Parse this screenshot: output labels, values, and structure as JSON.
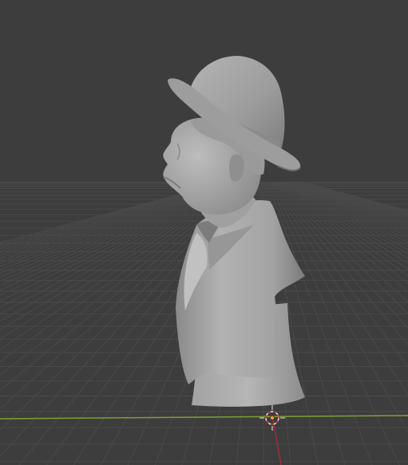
{
  "viewport": {
    "mode": "3d-viewport",
    "view": "perspective-side",
    "background_color": "#3d3d3d",
    "grid_color": "#4a4a4a",
    "x_axis_color": "#8db13a",
    "y_axis_color": "#b3334a",
    "model_color": "#a7a7a7",
    "model_shadow_color": "#6f6f6f",
    "cursor_icon": "3d-cursor-icon",
    "origin_icon": "object-origin-icon"
  }
}
